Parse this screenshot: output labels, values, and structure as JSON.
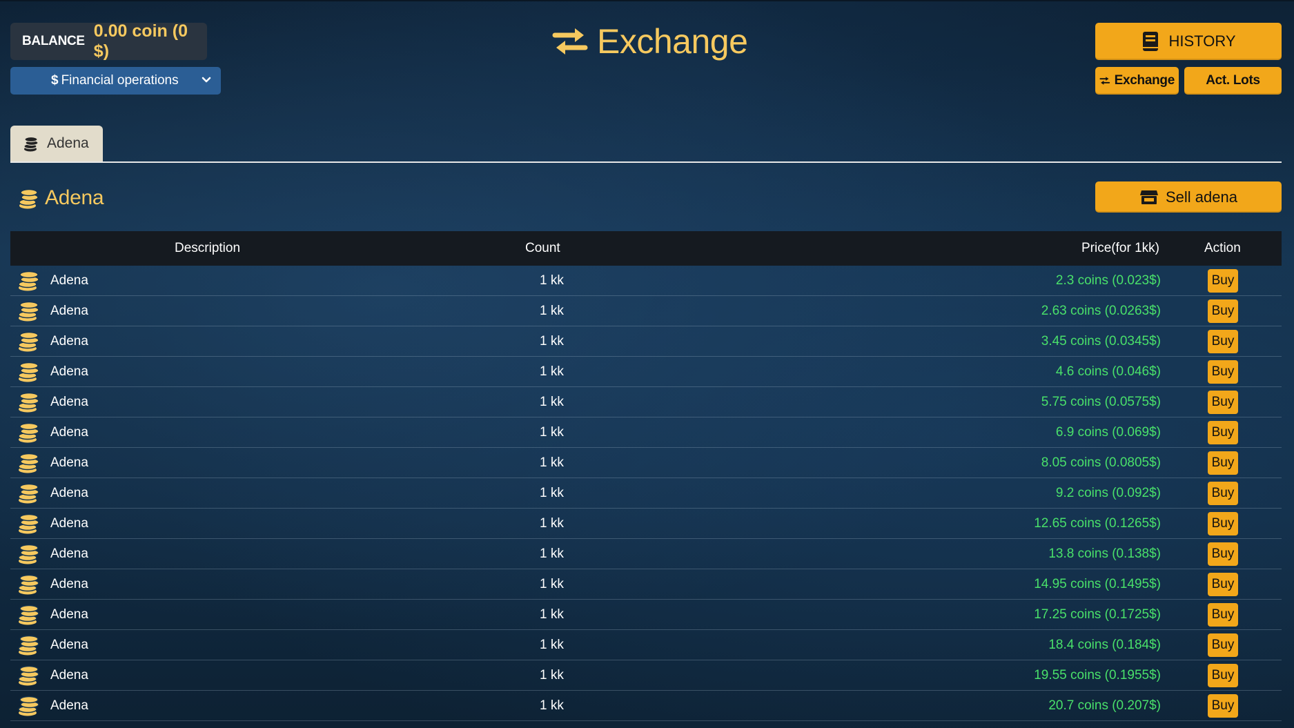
{
  "header": {
    "balance_label": "BALANCE",
    "balance_value": "0.00 coin (0 $)",
    "financial_button": "Financial operations",
    "financial_currency_symbol": "$",
    "title": "Exchange",
    "history_button": "HISTORY",
    "exchange_button": "Exchange",
    "act_lots_button": "Act. Lots"
  },
  "tabs": [
    {
      "label": "Adena",
      "icon": "coins-icon",
      "active": true
    }
  ],
  "section": {
    "title": "Adena",
    "sell_button": "Sell adena"
  },
  "table": {
    "headers": {
      "description": "Description",
      "count": "Count",
      "price": "Price(for 1kk)",
      "action": "Action"
    },
    "rows": [
      {
        "description": "Adena",
        "count": "1 kk",
        "price": "2.3 coins (0.023$)",
        "action": "Buy"
      },
      {
        "description": "Adena",
        "count": "1 kk",
        "price": "2.63 coins (0.0263$)",
        "action": "Buy"
      },
      {
        "description": "Adena",
        "count": "1 kk",
        "price": "3.45 coins (0.0345$)",
        "action": "Buy"
      },
      {
        "description": "Adena",
        "count": "1 kk",
        "price": "4.6 coins (0.046$)",
        "action": "Buy"
      },
      {
        "description": "Adena",
        "count": "1 kk",
        "price": "5.75 coins (0.0575$)",
        "action": "Buy"
      },
      {
        "description": "Adena",
        "count": "1 kk",
        "price": "6.9 coins (0.069$)",
        "action": "Buy"
      },
      {
        "description": "Adena",
        "count": "1 kk",
        "price": "8.05 coins (0.0805$)",
        "action": "Buy"
      },
      {
        "description": "Adena",
        "count": "1 kk",
        "price": "9.2 coins (0.092$)",
        "action": "Buy"
      },
      {
        "description": "Adena",
        "count": "1 kk",
        "price": "12.65 coins (0.1265$)",
        "action": "Buy"
      },
      {
        "description": "Adena",
        "count": "1 kk",
        "price": "13.8 coins (0.138$)",
        "action": "Buy"
      },
      {
        "description": "Adena",
        "count": "1 kk",
        "price": "14.95 coins (0.1495$)",
        "action": "Buy"
      },
      {
        "description": "Adena",
        "count": "1 kk",
        "price": "17.25 coins (0.1725$)",
        "action": "Buy"
      },
      {
        "description": "Adena",
        "count": "1 kk",
        "price": "18.4 coins (0.184$)",
        "action": "Buy"
      },
      {
        "description": "Adena",
        "count": "1 kk",
        "price": "19.55 coins (0.1955$)",
        "action": "Buy"
      },
      {
        "description": "Adena",
        "count": "1 kk",
        "price": "20.7 coins (0.207$)",
        "action": "Buy"
      }
    ]
  },
  "colors": {
    "accent_gold": "#f2a71a",
    "title_gold": "#f6c95f",
    "price_green": "#49e06a",
    "financial_blue": "#2b5e95"
  }
}
